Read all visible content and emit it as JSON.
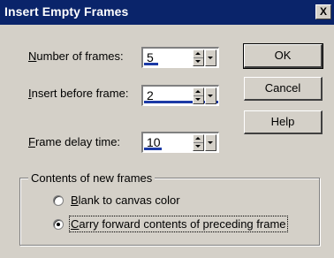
{
  "window": {
    "title": "Insert Empty Frames",
    "close_glyph": "X"
  },
  "fields": {
    "number_of_frames": {
      "label_hotkey": "N",
      "label_rest": "umber of frames:",
      "value": "5"
    },
    "insert_before_frame": {
      "label_hotkey": "I",
      "label_rest": "nsert before frame:",
      "value": "2"
    },
    "frame_delay_time": {
      "label_hotkey": "F",
      "label_rest": "rame delay time:",
      "value": "10"
    }
  },
  "buttons": {
    "ok": "OK",
    "cancel": "Cancel",
    "help": "Help"
  },
  "contents_group": {
    "legend": "Contents of new frames",
    "options": [
      {
        "hotkey": "B",
        "rest": "lank to canvas color",
        "selected": false
      },
      {
        "hotkey": "C",
        "rest": "arry forward contents of preceding frame",
        "selected": true
      }
    ]
  },
  "colors": {
    "title_bar": "#0a246a",
    "dialog_face": "#d4d0c8",
    "spin_indicator": "#1c3aa6"
  }
}
